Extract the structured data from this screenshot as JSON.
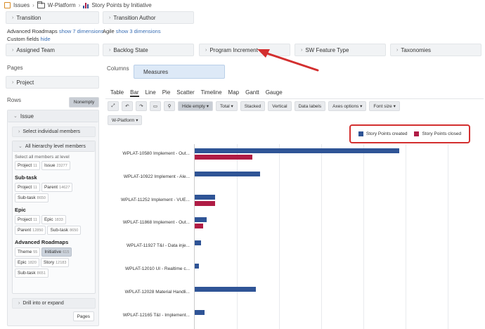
{
  "breadcrumb": {
    "items": [
      "Issues",
      "W-Platform",
      "Story Points by Initiative"
    ]
  },
  "top_dims": {
    "transition": "Transition",
    "transition_author": "Transition Author"
  },
  "dimension_links": {
    "advanced_roadmaps": "Advanced Roadmaps",
    "advanced_roadmaps_link": "show 7 dimensions",
    "agile": "Agile",
    "agile_link": "show 3 dimensions",
    "custom_fields": "Custom fields",
    "custom_fields_link": "hide"
  },
  "field_dims": [
    "Assigned Team",
    "Backlog State",
    "Program Increment",
    "SW Feature Type",
    "Taxonomies"
  ],
  "pages": {
    "header": "Pages",
    "project": "Project"
  },
  "columns": {
    "header": "Columns",
    "measures": "Measures"
  },
  "rows": {
    "header": "Rows",
    "nonempty": "Nonempty",
    "issue": "Issue",
    "select_individual": "Select individual members",
    "all_hierarchy": "All hierarchy level members",
    "select_all": "Select all members at level",
    "level_project": {
      "label": "Project",
      "count": "11"
    },
    "level_issue": {
      "label": "Issue",
      "count": "23277"
    },
    "subtask_header": "Sub-task",
    "subtask_tags": [
      {
        "label": "Project",
        "count": "11"
      },
      {
        "label": "Parent",
        "count": "14627"
      },
      {
        "label": "Sub-task",
        "count": "8650"
      }
    ],
    "epic_header": "Epic",
    "epic_tags": [
      {
        "label": "Project",
        "count": "11"
      },
      {
        "label": "Epic",
        "count": "1833"
      },
      {
        "label": "Parent",
        "count": "12850"
      },
      {
        "label": "Sub-task",
        "count": "8650"
      }
    ],
    "ar_header": "Advanced Roadmaps",
    "ar_tags": [
      {
        "label": "Theme",
        "count": "55"
      },
      {
        "label": "Initiative",
        "count": "615"
      },
      {
        "label": "Epic",
        "count": "1820"
      },
      {
        "label": "Story",
        "count": "12183"
      },
      {
        "label": "Sub-task",
        "count": "8651"
      }
    ],
    "drill": "Drill into or expand",
    "pages_btn": "Pages"
  },
  "chart_tabs": [
    "Table",
    "Bar",
    "Line",
    "Pie",
    "Scatter",
    "Timeline",
    "Map",
    "Gantt",
    "Gauge"
  ],
  "active_tab": "Bar",
  "toolbar": {
    "hide_empty": "Hide empty",
    "total": "Total",
    "stacked": "Stacked",
    "vertical": "Vertical",
    "data_labels": "Data labels",
    "axes_options": "Axes options",
    "font_size": "Font size",
    "filter": "W-Platform"
  },
  "colors": {
    "created": "#2f5496",
    "closed": "#b01c45",
    "highlight": "#d32f2f",
    "measures_bg": "#dde9f7"
  },
  "chart_data": {
    "type": "bar",
    "orientation": "horizontal",
    "categories": [
      "WPLAT-10580 Implement - Out...",
      "WPLAT-10922 Implement - Ale...",
      "WPLAT-11252 Implement - VUE...",
      "WPLAT-11868 Implement - Out...",
      "WPLAT-11927 T&I - Data inje...",
      "WPLAT-12010 UI - Realtime c...",
      "WPLAT-12028 Material Handli...",
      "WPLAT-12165 T&I - Implement..."
    ],
    "series": [
      {
        "name": "Story Points created",
        "values": [
          25,
          8,
          2.5,
          1.5,
          0.8,
          0.5,
          7.5,
          1.2
        ]
      },
      {
        "name": "Story Points closed",
        "values": [
          7,
          0,
          2.5,
          1,
          0,
          0,
          0,
          0
        ]
      }
    ],
    "xlim": [
      0,
      35
    ],
    "legend": "top-right",
    "grid": true
  }
}
